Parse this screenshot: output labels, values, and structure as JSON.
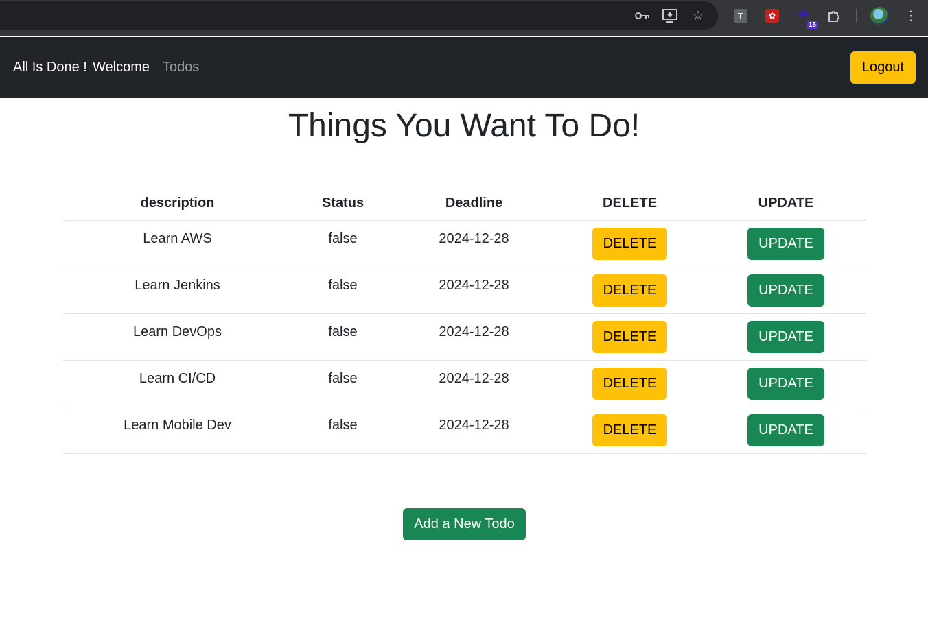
{
  "browser": {
    "icons": [
      "key-icon",
      "install-app-icon",
      "bookmark-star-icon",
      "extension-t-icon",
      "extension-red-icon",
      "extension-hat-icon",
      "extensions-puzzle-icon",
      "profile-avatar",
      "more-menu-icon"
    ],
    "extension_badge": "15"
  },
  "navbar": {
    "brand": "All Is Done ! ",
    "welcome": "Welcome",
    "todos": "Todos",
    "logout": "Logout"
  },
  "main": {
    "title": "Things You Want To Do!",
    "table": {
      "headers": [
        "description",
        "Status",
        "Deadline",
        "DELETE",
        "UPDATE"
      ],
      "rows": [
        {
          "description": "Learn AWS",
          "status": "false",
          "deadline": "2024-12-28",
          "delete": "DELETE",
          "update": "UPDATE"
        },
        {
          "description": "Learn Jenkins",
          "status": "false",
          "deadline": "2024-12-28",
          "delete": "DELETE",
          "update": "UPDATE"
        },
        {
          "description": "Learn DevOps",
          "status": "false",
          "deadline": "2024-12-28",
          "delete": "DELETE",
          "update": "UPDATE"
        },
        {
          "description": "Learn CI/CD",
          "status": "false",
          "deadline": "2024-12-28",
          "delete": "DELETE",
          "update": "UPDATE"
        },
        {
          "description": "Learn Mobile Dev",
          "status": "false",
          "deadline": "2024-12-28",
          "delete": "DELETE",
          "update": "UPDATE"
        }
      ]
    },
    "add_button": "Add a New Todo"
  },
  "colors": {
    "navbar_bg": "#212529",
    "warning": "#ffc107",
    "success": "#198754"
  }
}
